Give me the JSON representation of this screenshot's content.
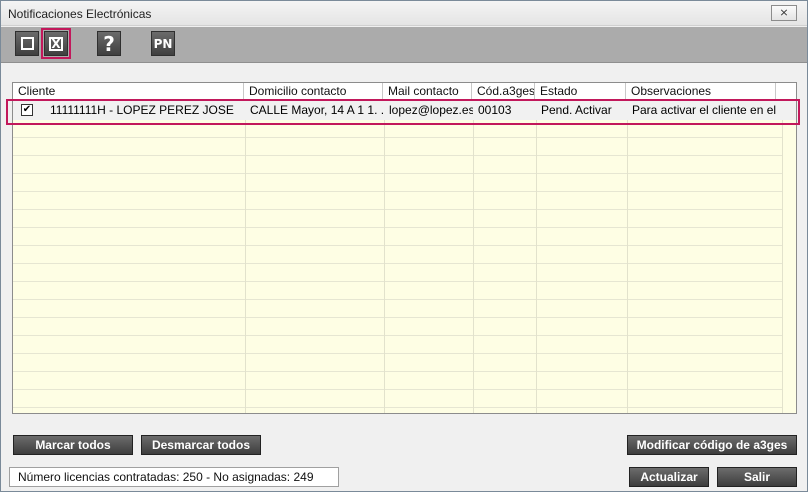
{
  "window": {
    "title": "Notificaciones Electrónicas",
    "close_glyph": "⨯"
  },
  "toolbar": {
    "buttons": [
      {
        "icon": "unchecked-box-icon"
      },
      {
        "icon": "checked-x-box-icon",
        "glyph": "X"
      },
      {
        "icon": "help-icon",
        "glyph": "?"
      },
      {
        "icon": "pn-icon",
        "glyph": "PN"
      }
    ]
  },
  "table": {
    "columns": [
      "Cliente",
      "Domicilio contacto",
      "Mail contacto",
      "Cód.a3ges",
      "Estado",
      "Observaciones"
    ],
    "rows": [
      {
        "checked": true,
        "check_glyph": "✔",
        "cliente": "11111111H - LOPEZ PEREZ JOSE",
        "domicilio": "CALLE Mayor, 14 A 1 1. ...",
        "mail": "lopez@lopez.es",
        "codigo": "00103",
        "estado": "Pend. Activar",
        "observaciones": "Para activar el cliente en el..."
      }
    ]
  },
  "buttons": {
    "marcar_todos": "Marcar todos",
    "desmarcar_todos": "Desmarcar todos",
    "modificar_codigo": "Modificar código de a3ges",
    "actualizar": "Actualizar",
    "salir": "Salir"
  },
  "status": {
    "text": "Número licencias contratadas: 250 - No asignadas: 249"
  },
  "colors": {
    "highlight": "#c2185b",
    "grid_bg": "#fefee4",
    "button_dark": "#3d3d3d"
  }
}
